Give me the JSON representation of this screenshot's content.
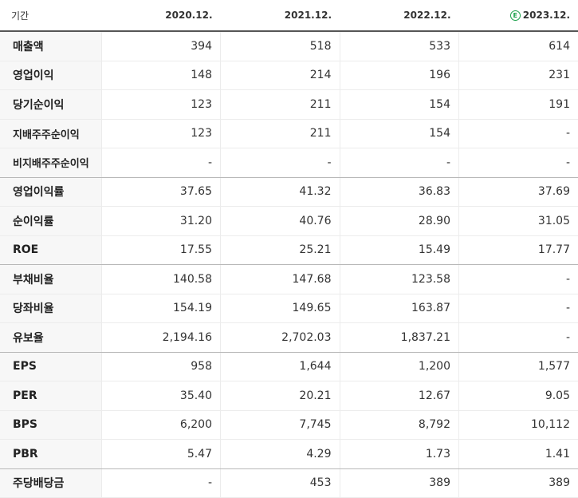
{
  "header": {
    "period_label": "기간",
    "columns": [
      "2020.12.",
      "2021.12.",
      "2022.12.",
      "2023.12."
    ],
    "estimate_badge": "E"
  },
  "rows": [
    {
      "label": "매출액",
      "values": [
        "394",
        "518",
        "533",
        "614"
      ]
    },
    {
      "label": "영업이익",
      "values": [
        "148",
        "214",
        "196",
        "231"
      ]
    },
    {
      "label": "당기순이익",
      "values": [
        "123",
        "211",
        "154",
        "191"
      ]
    },
    {
      "label": "지배주주순이익",
      "values": [
        "123",
        "211",
        "154",
        "-"
      ]
    },
    {
      "label": "비지배주주순이익",
      "values": [
        "-",
        "-",
        "-",
        "-"
      ]
    },
    {
      "label": "영업이익률",
      "values": [
        "37.65",
        "41.32",
        "36.83",
        "37.69"
      ]
    },
    {
      "label": "순이익률",
      "values": [
        "31.20",
        "40.76",
        "28.90",
        "31.05"
      ]
    },
    {
      "label": "ROE",
      "values": [
        "17.55",
        "25.21",
        "15.49",
        "17.77"
      ]
    },
    {
      "label": "부채비율",
      "values": [
        "140.58",
        "147.68",
        "123.58",
        "-"
      ]
    },
    {
      "label": "당좌비율",
      "values": [
        "154.19",
        "149.65",
        "163.87",
        "-"
      ]
    },
    {
      "label": "유보율",
      "values": [
        "2,194.16",
        "2,702.03",
        "1,837.21",
        "-"
      ]
    },
    {
      "label": "EPS",
      "values": [
        "958",
        "1,644",
        "1,200",
        "1,577"
      ]
    },
    {
      "label": "PER",
      "values": [
        "35.40",
        "20.21",
        "12.67",
        "9.05"
      ]
    },
    {
      "label": "BPS",
      "values": [
        "6,200",
        "7,745",
        "8,792",
        "10,112"
      ]
    },
    {
      "label": "PBR",
      "values": [
        "5.47",
        "4.29",
        "1.73",
        "1.41"
      ]
    },
    {
      "label": "주당배당금",
      "values": [
        "-",
        "453",
        "389",
        "389"
      ]
    }
  ]
}
